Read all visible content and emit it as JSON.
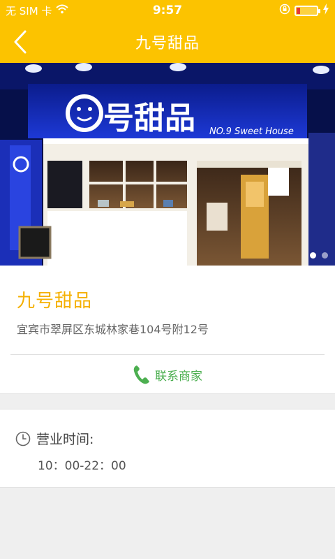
{
  "status_bar": {
    "carrier": "无 SIM 卡",
    "time": "9:57",
    "battery_level": 0.18,
    "icons": [
      "wifi-icon",
      "rotation-lock-icon",
      "battery-icon",
      "charging-icon"
    ]
  },
  "nav": {
    "title": "九号甜品",
    "back_icon": "chevron-left-icon"
  },
  "hero": {
    "image_description": "storefront photo",
    "sign_text": "号甜品",
    "sign_subtext": "NO.9 Sweet House",
    "carousel_pages": 2,
    "active_page": 1
  },
  "shop": {
    "name": "九号甜品",
    "address": "宜宾市翠屏区东城林家巷104号附12号",
    "contact_label": "联系商家",
    "contact_icon": "phone-icon"
  },
  "hours": {
    "title": "营业时间:",
    "value": "10：00-22：00",
    "icon": "clock-icon"
  },
  "colors": {
    "brand": "#fcc300",
    "shop_name": "#f5b000",
    "contact": "#4caf50",
    "background": "#efefef"
  }
}
